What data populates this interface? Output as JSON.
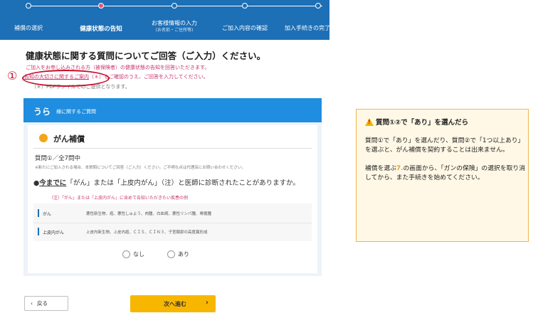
{
  "stepper": {
    "steps": [
      {
        "label": "補償の選択",
        "sub": ""
      },
      {
        "label": "健康状態の告知",
        "sub": ""
      },
      {
        "label": "お客様情報の入力",
        "sub": "(お名前・ご住所等)"
      },
      {
        "label": "ご加入内容の確認",
        "sub": ""
      },
      {
        "label": "加入手続きの完了",
        "sub": ""
      }
    ],
    "active_index": 1
  },
  "page": {
    "title": "健康状態に関する質問についてご回答（ご入力）ください。",
    "intro_line1": "ご加入をお申し込みされる方（被保険者）の健康状態の告知を回答いただきます。",
    "intro_link": "告知の大切さに関するご案内",
    "intro_line2_rest": "（＊）をご確認のうえ、ご回答を入力してください。",
    "intro_line3": "（＊）PDFファイルでのご提供となります。",
    "annotation_mark": "①"
  },
  "panel": {
    "person_name": "うら",
    "person_suffix": "様に関するご質問",
    "coverage_title": "がん補償",
    "question_count": "質問①／全7問中",
    "question_note": "※新たにご加入される場合、本質問についてご回答（ご入力）ください。ご不明な点は代理店にお問い合わせください。",
    "question_prefix": "●",
    "question_emph": "今までに",
    "question_rest": "「がん」または「上皮内がん」（注）と医師に診断されたことがありますか。",
    "question_sub": "（注）「がん」または「上皮内がん」に含めて告知いただきたい疾患の例",
    "definitions": [
      {
        "term": "がん",
        "examples": "悪性新生物、癌、悪性しゅよう、肉腫、白血病、悪性リンパ腫、骨髄腫"
      },
      {
        "term": "上皮内がん",
        "examples": "上皮内新生物、上皮内癌、ＣＩＳ、ＣＩＮ３、子宮頸部の高度異形成"
      }
    ],
    "answer_options": [
      "なし",
      "あり"
    ]
  },
  "note": {
    "heading": "質問①②で「あり」を選んだら",
    "para1": "質問①で「あり」を選んだり、質問②で「1つ以上あり」を選ぶと、がん補償を契約することは出来ません。",
    "para2_before": "補償を選ぶ",
    "para2_num": "7.",
    "para2_after": "の画面から、「ガンの保険」の選択を取り消してから、また手続きを始めてください。"
  },
  "buttons": {
    "back": "戻る",
    "next": "次へ進む"
  }
}
